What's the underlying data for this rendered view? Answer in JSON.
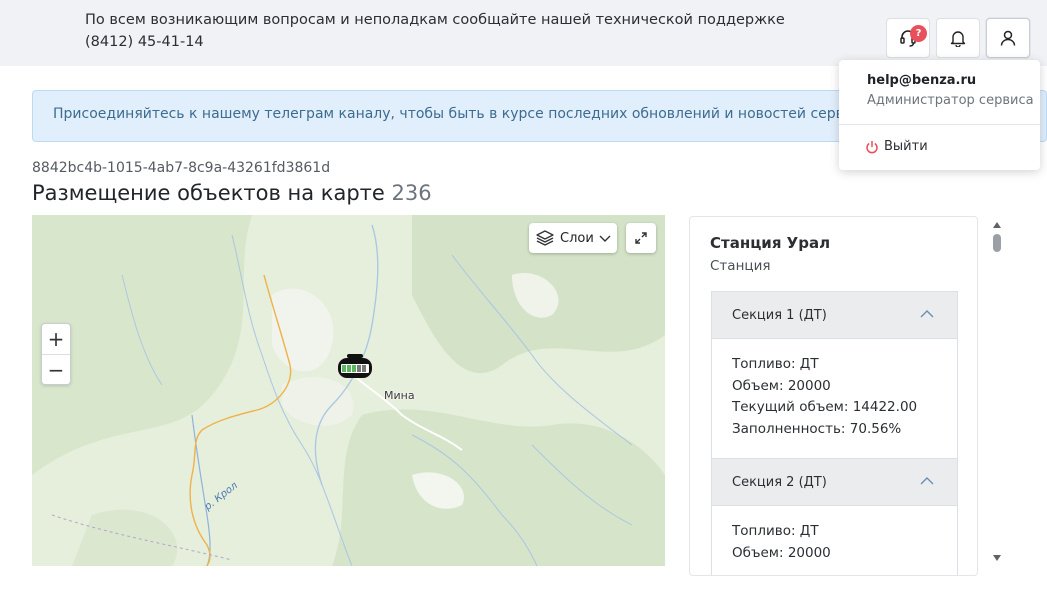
{
  "header": {
    "support_message": "По всем возникающим вопросам и неполадкам сообщайте нашей технической поддержке (8412) 45-41-14",
    "support_badge": "?"
  },
  "banner": {
    "text": "Присоединяйтесь к нашему телеграм каналу, чтобы быть в курсе последних обновлений и новостей сервисов benza"
  },
  "page": {
    "guid": "8842bc4b-1015-4ab7-8c9a-43261fd3861d",
    "title": "Размещение объектов на карте",
    "count": "236"
  },
  "map": {
    "layers_label": "Слои",
    "zoom_in": "+",
    "zoom_out": "−",
    "place_label": "Мина",
    "river_label": "р. Крол"
  },
  "station": {
    "name": "Станция Урал",
    "type": "Станция",
    "sections": [
      {
        "title": "Секция 1 (ДТ)",
        "fuel": "Топливо: ДТ",
        "volume": "Объем: 20000",
        "current_volume": "Текущий объем: 14422.00",
        "fill": "Заполненность: 70.56%"
      },
      {
        "title": "Секция 2 (ДТ)",
        "fuel": "Топливо: ДТ",
        "volume": "Объем: 20000"
      }
    ]
  },
  "user_menu": {
    "email": "help@benza.ru",
    "role": "Администратор сервиса",
    "logout": "Выйти"
  },
  "colors": {
    "accent": "#3d6c8f",
    "badge": "#e8505b",
    "logout_icon": "#e8505b",
    "marker_fill": "#5cb85c"
  }
}
